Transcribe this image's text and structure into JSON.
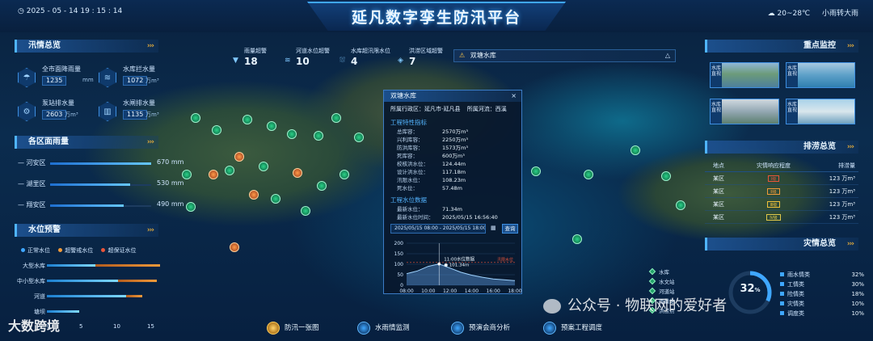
{
  "header": {
    "datetime": "2025 - 05 - 14   19 : 15 : 14",
    "title": "延凡数字孪生防汛平台",
    "weather_temp": "20~28℃",
    "weather_desc": "小雨转大雨"
  },
  "left": {
    "flood_title": "汛情总览",
    "stats": [
      {
        "label": "全市面降雨量",
        "value": "1235",
        "unit": "mm",
        "icon": "rain-icon"
      },
      {
        "label": "水库拦水量",
        "value": "1072",
        "unit": "万m³",
        "icon": "reservoir-icon"
      },
      {
        "label": "泵站排水量",
        "value": "2603",
        "unit": "万m³",
        "icon": "pump-icon"
      },
      {
        "label": "水闸排水量",
        "value": "1135",
        "unit": "万m³",
        "icon": "sluice-icon"
      }
    ],
    "rain_title": "各区面雨量",
    "rain_rows": [
      {
        "label": "河安区",
        "value": "670",
        "unit": "mm",
        "fraction": 1.0
      },
      {
        "label": "湖里区",
        "value": "530",
        "unit": "mm",
        "fraction": 0.79
      },
      {
        "label": "翔安区",
        "value": "490",
        "unit": "mm",
        "fraction": 0.73
      }
    ],
    "water_title": "水位预警",
    "legend": [
      "正常水位",
      "超警戒水位",
      "超保证水位"
    ],
    "legend_colors": [
      "#3fa7ff",
      "#f09a3a",
      "#e8553a"
    ],
    "water_rows": [
      {
        "label": "大型水库"
      },
      {
        "label": "中小型水库"
      },
      {
        "label": "河道"
      },
      {
        "label": "塘坝"
      }
    ],
    "axis_ticks": [
      "0",
      "5",
      "10",
      "15"
    ]
  },
  "kpis": [
    {
      "label": "雨量超警",
      "value": "18"
    },
    {
      "label": "河道水位超警",
      "value": "10"
    },
    {
      "label": "水库超汛限水位",
      "value": "4"
    },
    {
      "label": "洪涝区域超警",
      "value": "7"
    }
  ],
  "warn_bar": {
    "text": "双塘水库"
  },
  "popup": {
    "title": "双塘水库",
    "close": "×",
    "admin_label": "所属行政区：",
    "admin_value": "延凡市-延凡县",
    "river_label": "所属河流：",
    "river_value": "西溪",
    "sec1": "工程特性指标",
    "props": [
      {
        "k": "总库容：",
        "v": "2570万m³"
      },
      {
        "k": "兴利库容：",
        "v": "2250万m³"
      },
      {
        "k": "防洪库容：",
        "v": "1573万m³"
      },
      {
        "k": "死库容：",
        "v": "600万m³"
      },
      {
        "k": "校核洪水位：",
        "v": "124.44m"
      },
      {
        "k": "设计洪水位：",
        "v": "117.18m"
      },
      {
        "k": "汛限水位：",
        "v": "108.23m"
      },
      {
        "k": "死水位：",
        "v": "57.48m"
      }
    ],
    "sec2": "工程水位数据",
    "latest": [
      {
        "k": "最新水位：",
        "v": "71.34m"
      },
      {
        "k": "最新水位时间：",
        "v": "2025/05/15 16:56:40"
      }
    ],
    "range": "2025/05/15 08:00 - 2025/05/15 18:00",
    "query": "查询",
    "tooltip_time": "11:00水位数据",
    "tooltip_value": "● 101.34m",
    "limit_label": "汛限水位"
  },
  "chart_data": {
    "type": "area",
    "x": [
      "08:00",
      "10:00",
      "12:00",
      "14:00",
      "16:00",
      "18:00"
    ],
    "yticks": [
      "0",
      "50",
      "100",
      "150",
      "200"
    ],
    "ylim": [
      0,
      200
    ],
    "points": [
      [
        8,
        55
      ],
      [
        9,
        68
      ],
      [
        10,
        90
      ],
      [
        11,
        101.34
      ],
      [
        12,
        82
      ],
      [
        13,
        62
      ],
      [
        14,
        48
      ],
      [
        15,
        38
      ],
      [
        16,
        30
      ],
      [
        17,
        26
      ],
      [
        18,
        22
      ]
    ],
    "limit": 108.23
  },
  "right": {
    "monitor_title": "重点监控",
    "thumbs": [
      {
        "tag": "水库直视"
      },
      {
        "tag": "水库直视"
      },
      {
        "tag": "水库直视"
      },
      {
        "tag": "水库直视"
      }
    ],
    "drain_title": "排涝总览",
    "drain_headers": [
      "地点",
      "灾情响应程度",
      "排涝量"
    ],
    "drain_rows": [
      {
        "place": "某区",
        "level": "Ⅰ级",
        "amount": "123 万m³",
        "color": "#e8553a"
      },
      {
        "place": "某区",
        "level": "Ⅱ级",
        "amount": "123 万m³",
        "color": "#f09a3a"
      },
      {
        "place": "某区",
        "level": "Ⅲ级",
        "amount": "123 万m³",
        "color": "#f0c13a"
      },
      {
        "place": "某区",
        "level": "Ⅳ级",
        "amount": "123 万m³",
        "color": "#e0c84a"
      }
    ],
    "disaster_title": "灾情总览",
    "ring_value": "32",
    "ring_unit": "%",
    "ring_fraction": 0.32,
    "disaster_rows": [
      {
        "label": "雨水情类",
        "pct": "32%"
      },
      {
        "label": "工情类",
        "pct": "30%"
      },
      {
        "label": "险情类",
        "pct": "18%"
      },
      {
        "label": "灾情类",
        "pct": "10%"
      },
      {
        "label": "调度类",
        "pct": "10%"
      }
    ]
  },
  "map_legend": [
    "水库",
    "水文站",
    "河道站",
    "雨量站",
    "洪涝点"
  ],
  "bottom_nav": [
    "防汛一张图",
    "水雨情监测",
    "预演会商分析",
    "预案工程调度"
  ],
  "watermark": "大数跨境",
  "wechat": "公众号 · 物联网的爱好者"
}
